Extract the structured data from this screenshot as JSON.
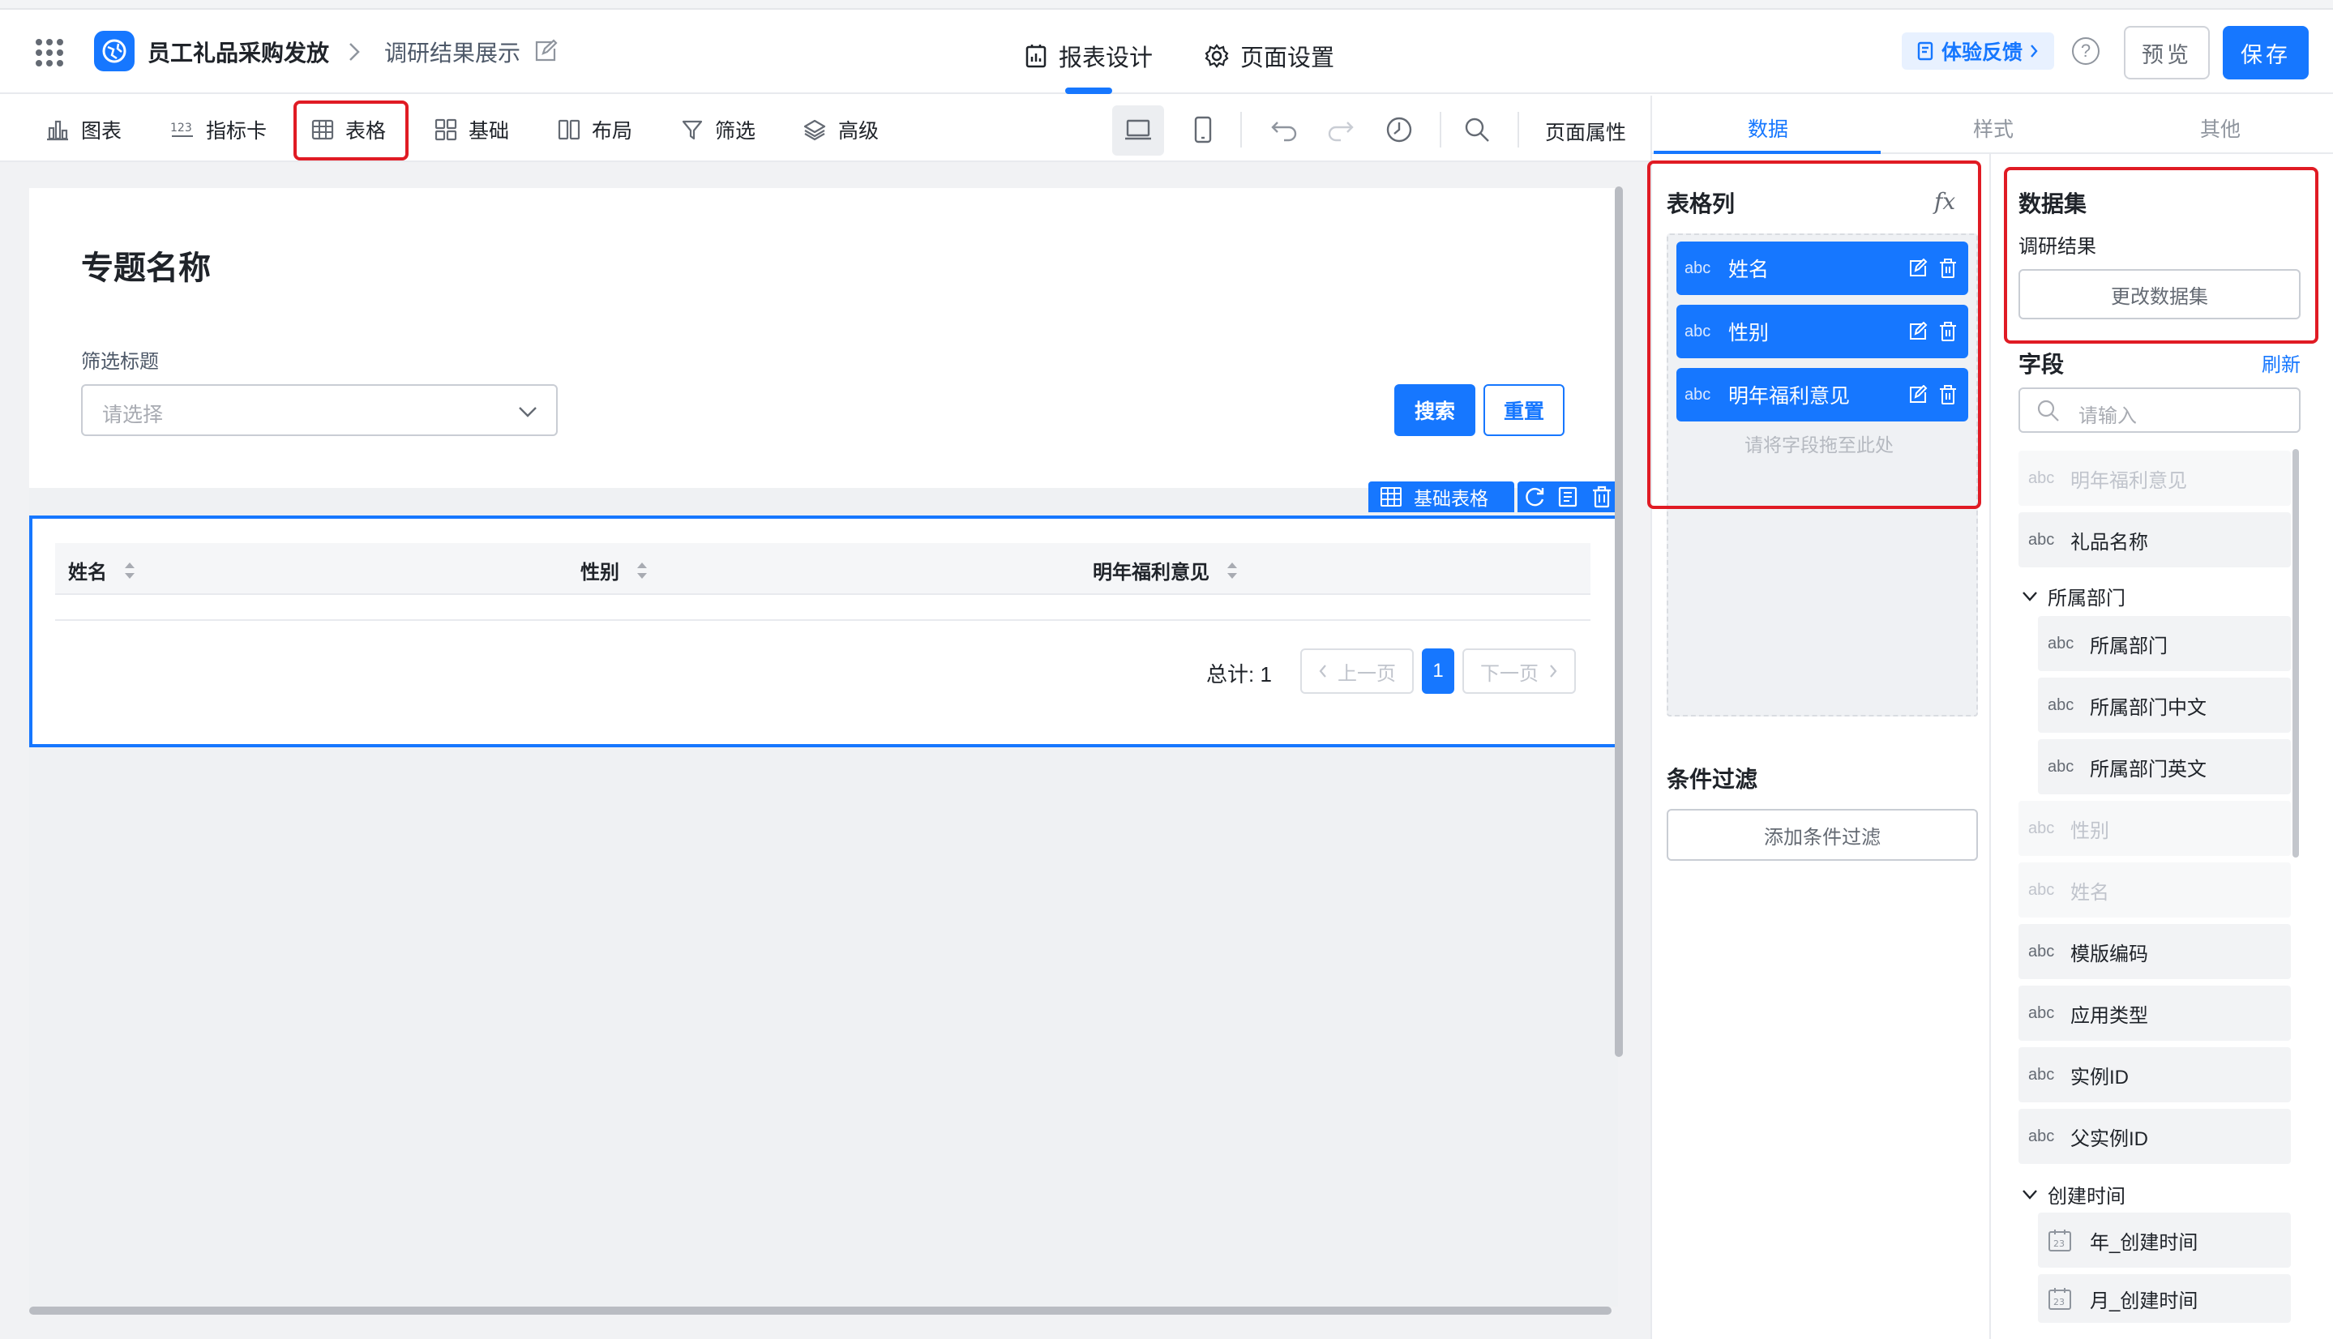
{
  "header": {
    "app_name": "员工礼品采购发放",
    "page_name": "调研结果展示",
    "mode_tabs": [
      {
        "label": "报表设计",
        "icon": "report-icon",
        "active": true
      },
      {
        "label": "页面设置",
        "icon": "gear-icon",
        "active": false
      }
    ],
    "feedback_label": "体验反馈",
    "help_label": "?",
    "preview_label": "预览",
    "save_label": "保存",
    "accent_color": "#1677ff"
  },
  "toolbar": {
    "items": [
      {
        "label": "图表",
        "icon": "bar-chart-icon"
      },
      {
        "label": "指标卡",
        "icon": "metric-card-icon"
      },
      {
        "label": "表格",
        "icon": "table-icon",
        "highlighted": true
      },
      {
        "label": "基础",
        "icon": "grid-icon"
      },
      {
        "label": "布局",
        "icon": "layout-icon"
      },
      {
        "label": "筛选",
        "icon": "filter-icon"
      },
      {
        "label": "高级",
        "icon": "layers-icon"
      }
    ],
    "page_props_label": "页面属性"
  },
  "canvas": {
    "topic_title": "专题名称",
    "filter_label": "筛选标题",
    "filter_placeholder": "请选择",
    "search_button": "搜索",
    "reset_button": "重置",
    "component_tag": "基础表格",
    "table": {
      "columns": [
        "姓名",
        "性别",
        "明年福利意见"
      ],
      "total_label": "总计: 1",
      "prev_label": "上一页",
      "next_label": "下一页",
      "current_page": "1"
    }
  },
  "right_panel": {
    "tabs": [
      {
        "label": "数据",
        "active": true
      },
      {
        "label": "样式",
        "active": false
      },
      {
        "label": "其他",
        "active": false
      }
    ],
    "table_columns": {
      "title": "表格列",
      "formula_icon": "fx",
      "fields": [
        {
          "type": "abc",
          "name": "姓名"
        },
        {
          "type": "abc",
          "name": "性别"
        },
        {
          "type": "abc",
          "name": "明年福利意见"
        }
      ],
      "drop_hint": "请将字段拖至此处"
    },
    "condition_filter": {
      "title": "条件过滤",
      "add_button": "添加条件过滤"
    },
    "dataset": {
      "title": "数据集",
      "name": "调研结果",
      "change_button": "更改数据集"
    },
    "fields": {
      "title": "字段",
      "refresh_label": "刷新",
      "search_placeholder": "请输入",
      "items": [
        {
          "kind": "field",
          "type": "abc",
          "name": "明年福利意见",
          "disabled": true
        },
        {
          "kind": "field",
          "type": "abc",
          "name": "礼品名称",
          "disabled": false
        },
        {
          "kind": "group",
          "name": "所属部门"
        },
        {
          "kind": "subfield",
          "type": "abc",
          "name": "所属部门",
          "disabled": false
        },
        {
          "kind": "subfield",
          "type": "abc",
          "name": "所属部门中文",
          "disabled": false
        },
        {
          "kind": "subfield",
          "type": "abc",
          "name": "所属部门英文",
          "disabled": false
        },
        {
          "kind": "field",
          "type": "abc",
          "name": "性别",
          "disabled": true
        },
        {
          "kind": "field",
          "type": "abc",
          "name": "姓名",
          "disabled": true
        },
        {
          "kind": "field",
          "type": "abc",
          "name": "模版编码",
          "disabled": false
        },
        {
          "kind": "field",
          "type": "abc",
          "name": "应用类型",
          "disabled": false
        },
        {
          "kind": "field",
          "type": "abc",
          "name": "实例ID",
          "disabled": false
        },
        {
          "kind": "field",
          "type": "abc",
          "name": "父实例ID",
          "disabled": false
        },
        {
          "kind": "group",
          "name": "创建时间"
        },
        {
          "kind": "datefield",
          "type": "date",
          "name": "年_创建时间",
          "disabled": false
        },
        {
          "kind": "datefield",
          "type": "date",
          "name": "月_创建时间",
          "disabled": false
        }
      ]
    }
  }
}
